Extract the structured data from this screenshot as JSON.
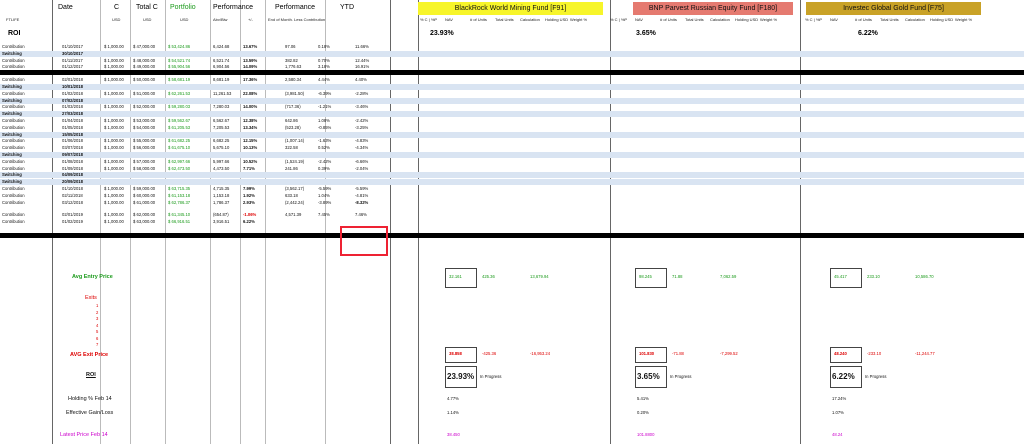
{
  "header": {
    "ftlife": "FTLIFE",
    "date": "Date",
    "c": "C",
    "total_c": "Total C",
    "portfolio": "Portfolio",
    "performance": "Performance",
    "performance2": "Performance",
    "ytd": "YTD",
    "usd1": "USD",
    "usd2": "USD",
    "usd3": "USD",
    "abv_blw": "Abv/Blw",
    "plus_minus": "+/-",
    "end_of_month": "End of Month. Less Contribution",
    "roi": "ROI",
    "roi_total": "23.93%"
  },
  "funds": [
    {
      "name": "BlackRock World Mining Fund [F91]",
      "color": "#f7f52a",
      "roi": "23.93%",
      "avg_entry": "32.161",
      "units_entry": "425.36",
      "total_entry": "13,679.94",
      "avg_exit": "38.858",
      "units_exit": "-425.36",
      "total_exit": "-16,953.24",
      "holding": "4.77%",
      "gain": "1.14%",
      "latest": "38.450"
    },
    {
      "name": "BNP Parvest Russian Equity Fund [F180]",
      "color": "#e57a70",
      "roi": "3.65%",
      "avg_entry": "98.245",
      "units_entry": "71.88",
      "total_entry": "7,062.59",
      "avg_exit": "101.830",
      "units_exit": "-71.88",
      "total_exit": "-7,299.52",
      "holding": "5.41%",
      "gain": "0.20%",
      "latest": "101.8800"
    },
    {
      "name": "Investec Global Gold Fund [F75]",
      "color": "#c9a227",
      "roi": "6.22%",
      "avg_entry": "45.417",
      "units_entry": "233.10",
      "total_entry": "10,586.70",
      "avg_exit": "48.240",
      "units_exit": "-233.10",
      "total_exit": "-11,244.77",
      "holding": "17.24%",
      "gain": "1.07%",
      "latest": "48.24"
    }
  ],
  "fund_cols": [
    "% C | %P",
    "NAV",
    "# of Units",
    "Total Units",
    "Calculation",
    "Holding USD",
    "Weight %"
  ],
  "rows": [
    {
      "t": "Contribution",
      "d": "01/10/2017",
      "c": "1,000.00",
      "tc": "47,000.00",
      "p": "53,424.86",
      "ab": "6,424.68",
      "pm": "13.67%",
      "em": "97.06",
      "ep": "0.18%",
      "y": "11.66%"
    },
    {
      "t": "Switching",
      "d": "30/10/2017",
      "sw": true
    },
    {
      "t": "Contribution",
      "d": "01/11/2017",
      "c": "1,000.00",
      "tc": "48,000.00",
      "p": "54,521.74",
      "ab": "6,521.74",
      "pm": "13.59%",
      "em": "382.82",
      "ep": "0.70%",
      "y": "12.44%"
    },
    {
      "t": "Contribution",
      "d": "01/12/2017",
      "c": "1,000.00",
      "tc": "49,000.00",
      "p": "55,904.56",
      "ab": "6,904.56",
      "pm": "14.09%",
      "em": "1,776.63",
      "ep": "3.18%",
      "y": "16.91%"
    },
    {
      "t": "Contribution",
      "d": "02/01/2018",
      "c": "1,000.00",
      "tc": "50,000.00",
      "p": "58,681.19",
      "ab": "8,681.19",
      "pm": "17.36%",
      "em": "2,580.34",
      "ep": "4.44%",
      "y": "4.40%"
    },
    {
      "t": "Switching",
      "d": "10/01/2018",
      "sw": true
    },
    {
      "t": "Contribution",
      "d": "01/02/2018",
      "c": "1,000.00",
      "tc": "51,000.00",
      "p": "62,261.53",
      "ab": "11,261.53",
      "pm": "22.08%",
      "em": "(3,981.50)",
      "ep": "-6.39%",
      "y": "-2.28%"
    },
    {
      "t": "Switching",
      "d": "07/02/2018",
      "sw": true
    },
    {
      "t": "Contribution",
      "d": "01/03/2018",
      "c": "1,000.00",
      "tc": "52,000.00",
      "p": "59,280.03",
      "ab": "7,280.03",
      "pm": "14.00%",
      "em": "(717.36)",
      "ep": "-1.21%",
      "y": "-3.46%"
    },
    {
      "t": "Switching",
      "d": "27/03/2018",
      "sw": true
    },
    {
      "t": "Contribution",
      "d": "01/04/2018",
      "c": "1,000.00",
      "tc": "53,000.00",
      "p": "59,562.67",
      "ab": "6,562.67",
      "pm": "12.38%",
      "em": "642.86",
      "ep": "1.08%",
      "y": "-2.42%"
    },
    {
      "t": "Contribution",
      "d": "01/05/2018",
      "c": "1,000.00",
      "tc": "54,000.00",
      "p": "61,205.53",
      "ab": "7,205.53",
      "pm": "13.34%",
      "em": "(523.28)",
      "ep": "-0.85%",
      "y": "-3.25%"
    },
    {
      "t": "Switching",
      "d": "15/05/2018",
      "sw": true
    },
    {
      "t": "Contribution",
      "d": "01/06/2018",
      "c": "1,000.00",
      "tc": "55,000.00",
      "p": "61,682.25",
      "ab": "6,682.25",
      "pm": "12.15%",
      "em": "(1,007.14)",
      "ep": "-1.63%",
      "y": "-4.83%"
    },
    {
      "t": "Contribution",
      "d": "03/07/2018",
      "c": "1,000.00",
      "tc": "56,000.00",
      "p": "61,675.10",
      "ab": "5,675.10",
      "pm": "10.13%",
      "em": "322.58",
      "ep": "0.52%",
      "y": "-4.34%"
    },
    {
      "t": "Switching",
      "d": "09/07/2018",
      "sw": true
    },
    {
      "t": "Contribution",
      "d": "01/08/2018",
      "c": "1,000.00",
      "tc": "57,000.00",
      "p": "62,997.66",
      "ab": "5,997.66",
      "pm": "10.52%",
      "em": "(1,524.19)",
      "ep": "-2.42%",
      "y": "-6.66%"
    },
    {
      "t": "Contribution",
      "d": "01/09/2018",
      "c": "1,000.00",
      "tc": "58,000.00",
      "p": "62,473.50",
      "ab": "4,473.50",
      "pm": "7.71%",
      "em": "241.86",
      "ep": "0.39%",
      "y": "-2.04%"
    },
    {
      "t": "Switching",
      "d": "04/09/2018",
      "sw": true
    },
    {
      "t": "Switching",
      "d": "20/09/2018",
      "sw": true
    },
    {
      "t": "Contribution",
      "d": "01/10/2018",
      "c": "1,000.00",
      "tc": "59,000.00",
      "p": "63,715.35",
      "ab": "4,715.35",
      "pm": "7.99%",
      "em": "(3,562.17)",
      "ep": "-5.59%",
      "y": "-5.59%"
    },
    {
      "t": "Contribution",
      "d": "02/11/2018",
      "c": "1,000.00",
      "tc": "60,000.00",
      "p": "61,153.18",
      "ab": "1,153.18",
      "pm": "1.92%",
      "em": "633.18",
      "ep": "1.04%",
      "y": "-4.81%"
    },
    {
      "t": "Contribution",
      "d": "03/12/2018",
      "c": "1,000.00",
      "tc": "61,000.00",
      "p": "62,786.37",
      "ab": "1,786.37",
      "pm": "2.93%",
      "em": "(2,442.24)",
      "ep": "-3.89%",
      "y": "-8.32%"
    },
    {
      "t": "Contribution",
      "d": "02/01/2019",
      "c": "1,000.00",
      "tc": "62,000.00",
      "p": "61,345.10",
      "ab": "(654.87)",
      "pm": "-1.06%",
      "em": "4,571.39",
      "ep": "7.45%",
      "y": "7.46%"
    },
    {
      "t": "Contribution",
      "d": "01/02/2019",
      "c": "1,000.00",
      "tc": "63,000.00",
      "p": "66,916.51",
      "ab": "3,916.51",
      "pm": "6.22%",
      "em": "",
      "ep": "",
      "y": ""
    }
  ],
  "summary": {
    "avg_entry": "Avg Entry Price",
    "exits": "Exits",
    "avg_exit": "AVG Exit Price",
    "roi": "ROI",
    "in_progress": "In Progress",
    "holding": "Holding % Feb 14",
    "gain": "Effective Gain/Loss",
    "latest": "Latest Price Feb 14",
    "exit_nums": [
      "1",
      "2",
      "3",
      "4",
      "5",
      "6",
      "7"
    ]
  },
  "colors": {
    "accent_green": "#1a9a1a",
    "neg_red": "#d00",
    "highlight_box": "#e23",
    "switch_blue": "#d9e4f2"
  }
}
